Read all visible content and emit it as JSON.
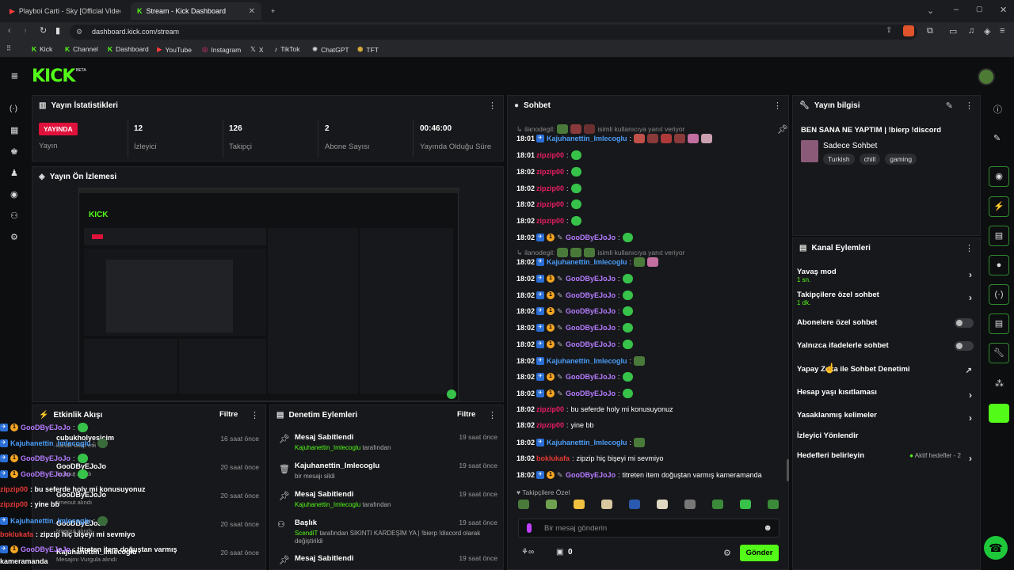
{
  "browser": {
    "tabs": [
      {
        "label": "Playboi Carti - Sky [Official Video"
      },
      {
        "label": "Stream - Kick Dashboard"
      }
    ],
    "url": "dashboard.kick.com/stream",
    "bookmarks": [
      "Kick",
      "Channel",
      "Dashboard",
      "YouTube",
      "Instagram",
      "X",
      "TikTok",
      "ChatGPT",
      "TFT"
    ]
  },
  "header": {
    "logo": "KICK",
    "logo_sup": "BETA"
  },
  "stats": {
    "title": "Yayın İstatistikleri",
    "items": [
      {
        "value": "YAYINDA",
        "label": "Yayın"
      },
      {
        "value": "12",
        "label": "İzleyici"
      },
      {
        "value": "126",
        "label": "Takipçi"
      },
      {
        "value": "2",
        "label": "Abone Sayısı"
      },
      {
        "value": "00:46:00",
        "label": "Yayında Olduğu Süre"
      }
    ]
  },
  "preview": {
    "title": "Yayın Ön İzlemesi"
  },
  "activity": {
    "title": "Etkinlik Akışı",
    "filter": "Filtre",
    "items": [
      {
        "user": "cubukholyesicim",
        "text": "kanalı takip etti",
        "time": "16 saat önce"
      },
      {
        "user": "GooDByEJoJo",
        "text": "limeout alındı",
        "time": "20 saat önce"
      },
      {
        "user": "GooDByEJoJo",
        "text": "timeout alındı",
        "time": "20 saat önce"
      },
      {
        "user": "GooDByEJoJo",
        "text": "timeout alındı",
        "time": "20 saat önce"
      },
      {
        "user": "Kajuhanettin_Imlecoglu",
        "text": "Mesajını Vurgula alındı",
        "time": "20 saat önce"
      }
    ]
  },
  "moderation": {
    "title": "Denetim Eylemleri",
    "filter": "Filtre",
    "items": [
      {
        "title": "Mesaj Sabitlendi",
        "who": "Kajuhanettin_Imlecoglu",
        "suffix": "tarafından",
        "time": "19 saat önce"
      },
      {
        "title": "Kajuhanettin_Imlecoglu",
        "who": "",
        "suffix": "bir mesajı sildi",
        "time": "19 saat önce"
      },
      {
        "title": "Mesaj Sabitlendi",
        "who": "Kajuhanettin_Imlecoglu",
        "suffix": "tarafından",
        "time": "19 saat önce"
      },
      {
        "title": "Başlık",
        "who": "ScendiT",
        "suffix": "tarafından SIKINTI KARDEŞİM YA | !bierp !discord olarak değiştirildi",
        "time": "19 saat önce"
      },
      {
        "title": "Mesaj Sabitlendi",
        "who": "",
        "suffix": "",
        "time": "19 saat önce"
      }
    ]
  },
  "overlay_chat": [
    {
      "user": "GooDByEJoJo",
      "text": ":"
    },
    {
      "user": "Kajuhanettin_Imlecoglu",
      "text": ":"
    },
    {
      "user": "GooDByEJoJo",
      "text": ":"
    },
    {
      "user": "GooDByEJoJo",
      "text": ":"
    },
    {
      "user": "zipzip00",
      "text": ": bu seferde holy mi konusuyonuz"
    },
    {
      "user": "zipzip00",
      "text": ": yine bb"
    },
    {
      "user": "Kajuhanettin_Imlecoglu",
      "text": ":"
    },
    {
      "user": "boklukafa",
      "text": ": zipzip hiç bişeyi mi sevmiyo"
    },
    {
      "user": "GooDByEJoJo",
      "text": ": titreten item doğuştan varmış"
    },
    {
      "user": "",
      "text": "kameramanda"
    }
  ],
  "chat": {
    "title": "Sohbet",
    "reply_prefix": "ilanodegil:",
    "reply_suffix": "isimli kullanıcıya yanıt veriyor",
    "messages": [
      {
        "time": "18:01",
        "user": "Kajuhanettin_Imlecoglu",
        "text": ""
      },
      {
        "time": "18:01",
        "user": "zipzip00",
        "text": ""
      },
      {
        "time": "18:02",
        "user": "zipzip00",
        "text": ""
      },
      {
        "time": "18:02",
        "user": "zipzip00",
        "text": ""
      },
      {
        "time": "18:02",
        "user": "zipzip00",
        "text": ""
      },
      {
        "time": "18:02",
        "user": "zipzip00",
        "text": ""
      },
      {
        "time": "18:02",
        "user": "GooDByEJoJo",
        "text": ""
      },
      {
        "time": "18:02",
        "user": "Kajuhanettin_Imlecoglu",
        "text": ""
      },
      {
        "time": "18:02",
        "user": "GooDByEJoJo",
        "text": ""
      },
      {
        "time": "18:02",
        "user": "GooDByEJoJo",
        "text": ""
      },
      {
        "time": "18:02",
        "user": "GooDByEJoJo",
        "text": ""
      },
      {
        "time": "18:02",
        "user": "GooDByEJoJo",
        "text": ""
      },
      {
        "time": "18:02",
        "user": "GooDByEJoJo",
        "text": ""
      },
      {
        "time": "18:02",
        "user": "Kajuhanettin_Imlecoglu",
        "text": ""
      },
      {
        "time": "18:02",
        "user": "GooDByEJoJo",
        "text": ""
      },
      {
        "time": "18:02",
        "user": "GooDByEJoJo",
        "text": ""
      },
      {
        "time": "18:02",
        "user": "zipzip00",
        "text": "bu seferde holy mi konusuyonuz"
      },
      {
        "time": "18:02",
        "user": "zipzip00",
        "text": "yine bb"
      },
      {
        "time": "18:02",
        "user": "Kajuhanettin_Imlecoglu",
        "text": ""
      },
      {
        "time": "18:02",
        "user": "boklukafa",
        "text": "zipzip hiç bişeyi mi sevmiyo"
      },
      {
        "time": "18:02",
        "user": "GooDByEJoJo",
        "text": "titreten item doğuştan varmış kameramanda"
      }
    ],
    "emote_label": "Takipçilere Özel",
    "input_placeholder": "Bir mesaj gönderin",
    "points": "0",
    "send": "Gönder"
  },
  "stream_info": {
    "title": "Yayın bilgisi",
    "stream_title": "BEN SANA NE YAPTIM | !bierp !discord",
    "category": "Sadece Sohbet",
    "tags": [
      "Turkish",
      "chill",
      "gaming"
    ]
  },
  "channel_actions": {
    "title": "Kanal Eylemleri",
    "items": [
      {
        "label": "Yavaş mod",
        "sub": "1 sn."
      },
      {
        "label": "Takipçilere özel sohbet",
        "sub": "1 dk."
      },
      {
        "label": "Abonelere özel sohbet",
        "sub": ""
      },
      {
        "label": "Yalnızca ifadelerle sohbet",
        "sub": ""
      },
      {
        "label": "Yapay Zeka ile Sohbet Denetimi",
        "sub": ""
      },
      {
        "label": "Hesap yaşı kısıtlaması",
        "sub": ""
      },
      {
        "label": "Yasaklanmış kelimeler",
        "sub": ""
      },
      {
        "label": "İzleyici Yönlendir",
        "sub": ""
      },
      {
        "label": "Hedefleri belirleyin",
        "sub": ""
      }
    ],
    "goals_status": "Aktif hedefler - 2"
  },
  "colors": {
    "accent": "#53fc18",
    "live": "#e0113b",
    "panel": "#17181b"
  }
}
